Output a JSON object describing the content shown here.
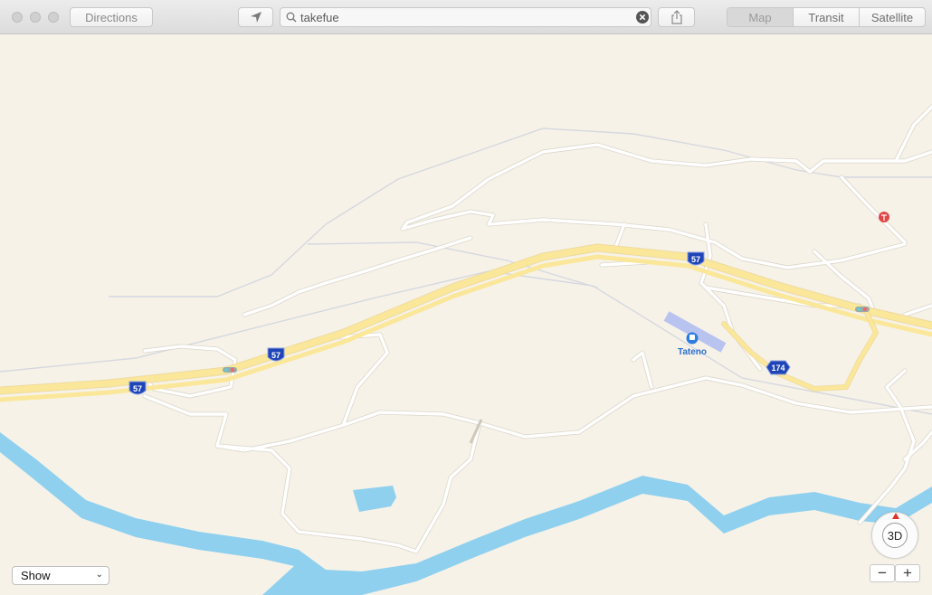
{
  "toolbar": {
    "directions_label": "Directions",
    "search": {
      "value": "takefue",
      "placeholder": "Search"
    },
    "view_modes": [
      {
        "label": "Map",
        "active": true
      },
      {
        "label": "Transit",
        "active": false
      },
      {
        "label": "Satellite",
        "active": false
      }
    ]
  },
  "map": {
    "station_label": "Tateno",
    "route_shields": [
      "57",
      "57",
      "57",
      "174"
    ],
    "colors": {
      "land": "#f6f2e8",
      "water": "#8fd0ef",
      "highway": "#fbe79a",
      "road": "#ffffff",
      "rail": "#d6d8e0"
    }
  },
  "controls": {
    "show_label": "Show",
    "compass_label": "3D",
    "zoom_out": "−",
    "zoom_in": "+"
  }
}
